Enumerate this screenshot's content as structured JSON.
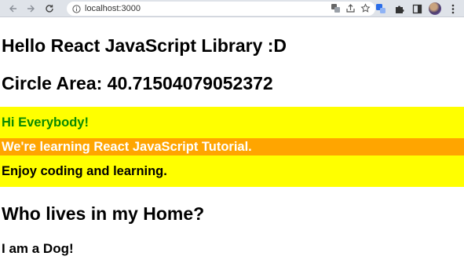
{
  "browser": {
    "url": "localhost:3000"
  },
  "page": {
    "heading1": "Hello React JavaScript Library :D",
    "heading2": "Circle Area: 40.71504079052372",
    "banner1": "Hi Everybody!",
    "banner2": "We're learning React JavaScript Tutorial.",
    "banner3": "Enjoy coding and learning.",
    "home_title": "Who lives in my Home?",
    "pet_text": "I am a Dog!"
  },
  "colors": {
    "banner1_bg": "#ffff00",
    "banner1_fg": "#0a8a00",
    "banner2_bg": "#ffa500",
    "banner2_fg": "#ffffff",
    "banner3_bg": "#ffff00",
    "banner3_fg": "#000000"
  }
}
